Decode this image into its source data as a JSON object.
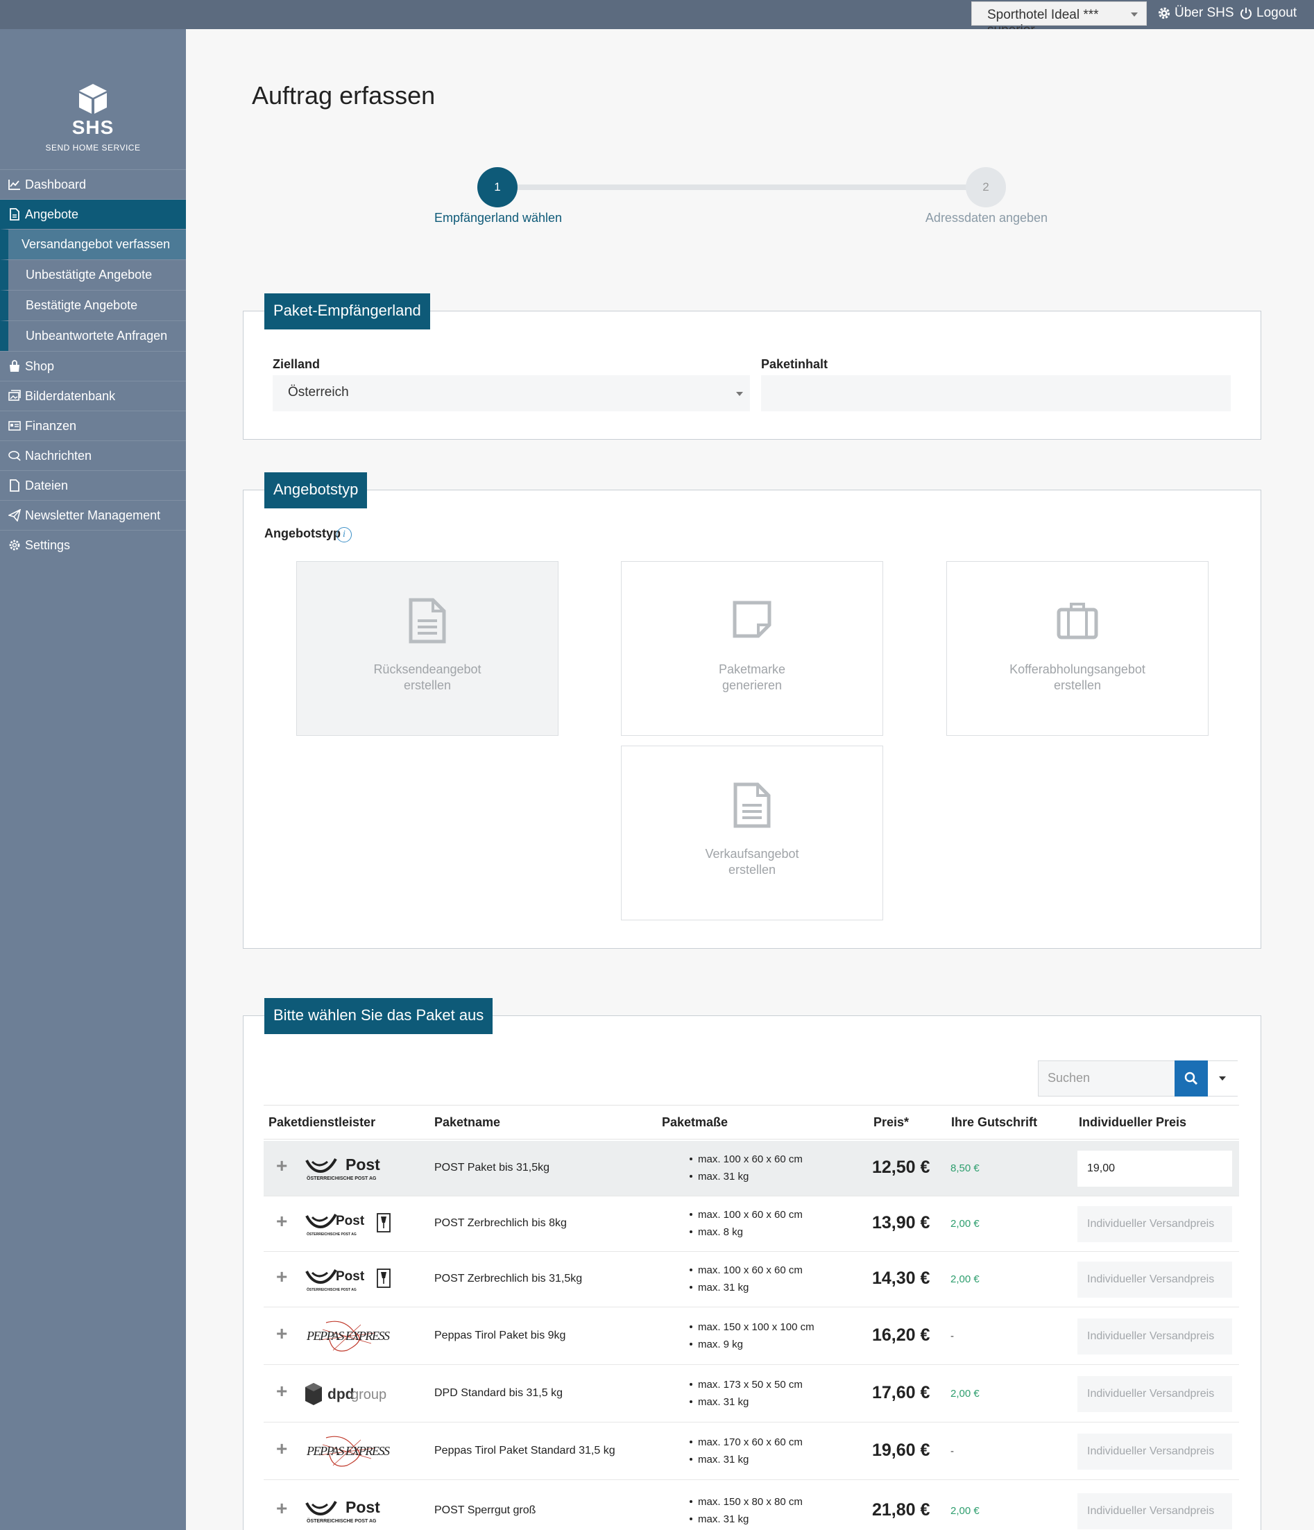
{
  "topbar": {
    "hotel": "Sporthotel Ideal *** superior",
    "about": "Über SHS",
    "logout": "Logout"
  },
  "logo": {
    "name": "SHS",
    "subtitle": "SEND HOME SERVICE"
  },
  "sidebar": {
    "items": [
      {
        "label": "Dashboard",
        "icon": "chart-icon"
      },
      {
        "label": "Angebote",
        "icon": "file-icon"
      },
      {
        "label": "Shop",
        "icon": "bag-icon"
      },
      {
        "label": "Bilderdatenbank",
        "icon": "images-icon"
      },
      {
        "label": "Finanzen",
        "icon": "card-icon"
      },
      {
        "label": "Nachrichten",
        "icon": "comments-icon"
      },
      {
        "label": "Dateien",
        "icon": "document-icon"
      },
      {
        "label": "Newsletter Management",
        "icon": "paper-plane-icon"
      },
      {
        "label": "Settings",
        "icon": "gear-icon"
      }
    ],
    "subitems": [
      "Versandangebot verfassen",
      "Unbestätigte Angebote",
      "Bestätigte Angebote",
      "Unbeantwortete Anfragen"
    ]
  },
  "page": {
    "title": "Auftrag erfassen"
  },
  "stepper": {
    "steps": [
      {
        "number": "1",
        "label": "Empfängerland wählen"
      },
      {
        "number": "2",
        "label": "Adressdaten angeben"
      }
    ]
  },
  "country_panel": {
    "title": "Paket-Empfängerland",
    "country_label": "Zielland",
    "country_value": "Österreich",
    "content_label": "Paketinhalt",
    "content_value": ""
  },
  "offer_panel": {
    "title": "Angebotstyp",
    "label": "Angebotstyp",
    "info": "i",
    "cards": [
      {
        "line1": "Rücksendeangebot",
        "line2": "erstellen"
      },
      {
        "line1": "Paketmarke",
        "line2": "generieren"
      },
      {
        "line1": "Kofferabholungsangebot",
        "line2": "erstellen"
      },
      {
        "line1": "Verkaufsangebot",
        "line2": "erstellen"
      }
    ]
  },
  "package_panel": {
    "title": "Bitte wählen Sie das Paket aus",
    "search_placeholder": "Suchen",
    "columns": [
      "Paketdienstleister",
      "Paketname",
      "Paketmaße",
      "Preis*",
      "Ihre Gutschrift",
      "Individueller Preis"
    ],
    "indiv_placeholder": "Individueller Versandpreis",
    "rows": [
      {
        "provider": "post",
        "name": "POST Paket bis 31,5kg",
        "dim": "max. 100 x 60 x 60 cm",
        "weight": "max. 31 kg",
        "price": "12,50 €",
        "credit": "8,50 €",
        "indiv": "19,00"
      },
      {
        "provider": "post-fragile",
        "name": "POST Zerbrechlich bis 8kg",
        "dim": "max. 100 x 60 x 60 cm",
        "weight": "max. 8 kg",
        "price": "13,90 €",
        "credit": "2,00 €",
        "indiv": ""
      },
      {
        "provider": "post-fragile",
        "name": "POST Zerbrechlich bis 31,5kg",
        "dim": "max. 100 x 60 x 60 cm",
        "weight": "max. 31 kg",
        "price": "14,30 €",
        "credit": "2,00 €",
        "indiv": ""
      },
      {
        "provider": "peppas",
        "name": "Peppas Tirol Paket bis 9kg",
        "dim": "max. 150 x 100 x 100 cm",
        "weight": "max. 9 kg",
        "price": "16,20 €",
        "credit": "-",
        "indiv": ""
      },
      {
        "provider": "dpd",
        "name": "DPD Standard bis 31,5 kg",
        "dim": "max. 173 x 50 x 50 cm",
        "weight": "max. 31 kg",
        "price": "17,60 €",
        "credit": "2,00 €",
        "indiv": ""
      },
      {
        "provider": "peppas",
        "name": "Peppas Tirol Paket Standard 31,5 kg",
        "dim": "max. 170 x 60 x 60 cm",
        "weight": "max. 31 kg",
        "price": "19,60 €",
        "credit": "-",
        "indiv": ""
      },
      {
        "provider": "post",
        "name": "POST Sperrgut groß",
        "dim": "max. 150 x 80 x 80 cm",
        "weight": "max. 31 kg",
        "price": "21,80 €",
        "credit": "2,00 €",
        "indiv": ""
      }
    ],
    "logo_text": {
      "post": "Post",
      "post_sub": "ÖSTERREICHISCHE POST AG",
      "peppas": "PEPPAS EXPRESS",
      "dpd": "dpd",
      "dpd_suffix": "group"
    }
  }
}
